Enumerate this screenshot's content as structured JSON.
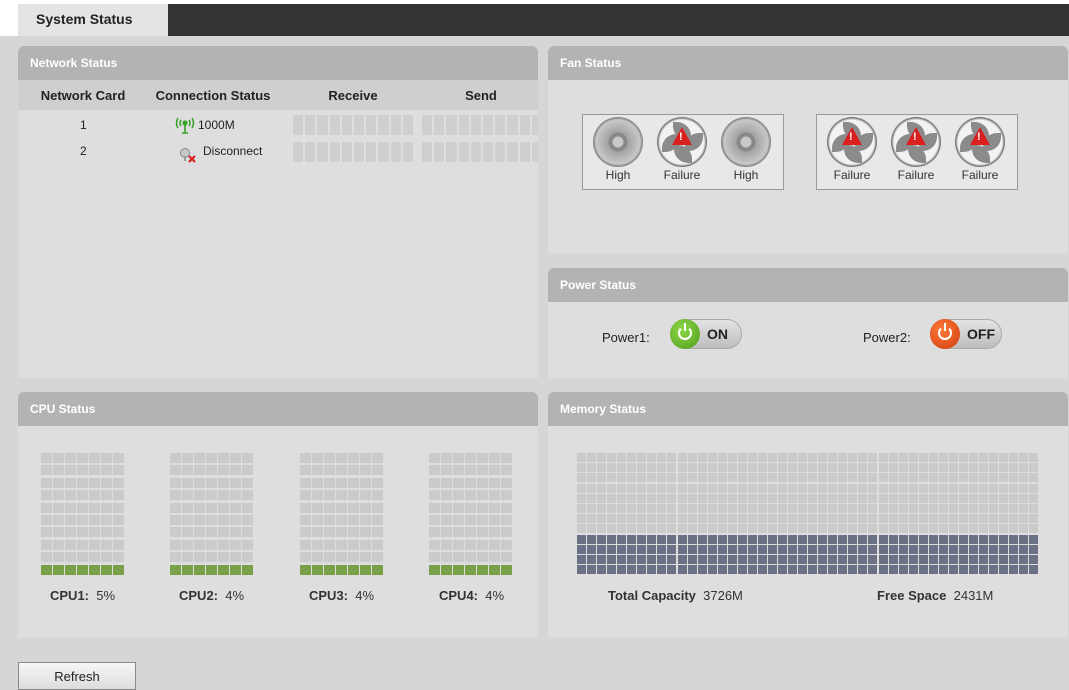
{
  "tab": {
    "label": "System Status"
  },
  "network": {
    "title": "Network Status",
    "headers": [
      "Network Card",
      "Connection Status",
      "Receive",
      "Send"
    ],
    "rows": [
      {
        "card": "1",
        "status": "1000M",
        "icon": "wireless-connected-icon",
        "status_color": "#3aa52a"
      },
      {
        "card": "2",
        "status": "Disconnect",
        "icon": "disconnected-icon",
        "status_color": "#d62020"
      }
    ]
  },
  "fans": {
    "title": "Fan Status",
    "group1": [
      {
        "label": "High",
        "state": "ok"
      },
      {
        "label": "Failure",
        "state": "fail"
      },
      {
        "label": "High",
        "state": "ok"
      }
    ],
    "group2": [
      {
        "label": "Failure",
        "state": "fail"
      },
      {
        "label": "Failure",
        "state": "fail"
      },
      {
        "label": "Failure",
        "state": "fail"
      }
    ]
  },
  "power": {
    "title": "Power Status",
    "items": [
      {
        "label": "Power1:",
        "state": "ON",
        "color": "#5aa82a"
      },
      {
        "label": "Power2:",
        "state": "OFF",
        "color": "#e0481a"
      }
    ]
  },
  "cpu": {
    "title": "CPU Status",
    "items": [
      {
        "label": "CPU1:",
        "value": "5%",
        "usage": 5
      },
      {
        "label": "CPU2:",
        "value": "4%",
        "usage": 4
      },
      {
        "label": "CPU3:",
        "value": "4%",
        "usage": 4
      },
      {
        "label": "CPU4:",
        "value": "4%",
        "usage": 4
      }
    ],
    "used_color": "#7aa14a"
  },
  "memory": {
    "title": "Memory Status",
    "total_label": "Total Capacity",
    "total_value": "3726M",
    "free_label": "Free Space",
    "free_value": "2431M",
    "used_color": "#6b7185"
  },
  "refresh_label": "Refresh"
}
